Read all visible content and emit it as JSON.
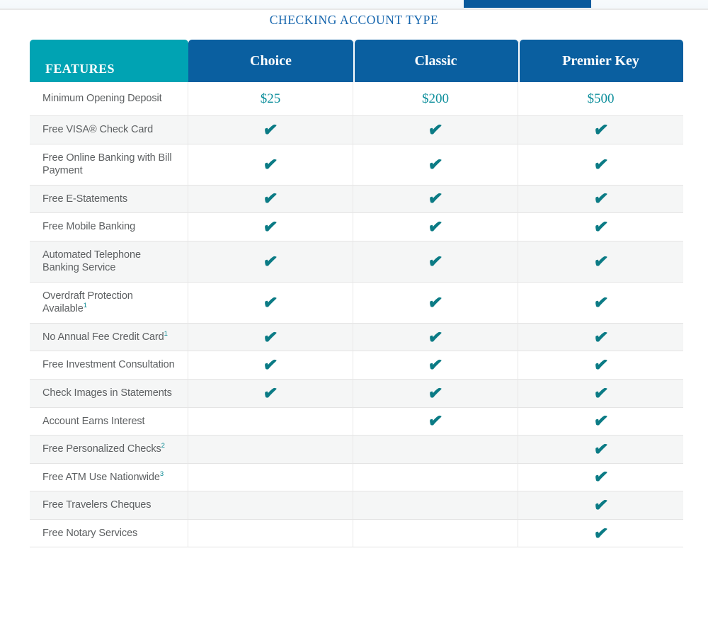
{
  "topbar": {
    "active_tab_label": ""
  },
  "page": {
    "title": "CHECKING ACCOUNT TYPE"
  },
  "colors": {
    "teal": "#00a3b3",
    "blue": "#0a5fa0",
    "check_teal": "#0b7b85",
    "price_teal": "#0e8f9c",
    "title_blue": "#1565ad",
    "row_stripe": "#f5f6f6",
    "feature_text": "#5d6062"
  },
  "table": {
    "features_header": "FEATURES",
    "columns": [
      {
        "label": "Choice"
      },
      {
        "label": "Classic"
      },
      {
        "label": "Premier Key"
      }
    ],
    "check_glyph": "✔",
    "rows": [
      {
        "feature": "Minimum Opening Deposit",
        "footnote": "",
        "type": "text",
        "values": [
          "$25",
          "$200",
          "$500"
        ]
      },
      {
        "feature": "Free VISA® Check Card",
        "footnote": "",
        "type": "check",
        "values": [
          true,
          true,
          true
        ]
      },
      {
        "feature": "Free Online Banking with Bill Payment",
        "footnote": "",
        "type": "check",
        "values": [
          true,
          true,
          true
        ]
      },
      {
        "feature": "Free E-Statements",
        "footnote": "",
        "type": "check",
        "values": [
          true,
          true,
          true
        ]
      },
      {
        "feature": "Free Mobile Banking",
        "footnote": "",
        "type": "check",
        "values": [
          true,
          true,
          true
        ]
      },
      {
        "feature": "Automated Telephone Banking Service",
        "footnote": "",
        "type": "check",
        "values": [
          true,
          true,
          true
        ]
      },
      {
        "feature": "Overdraft Protection Available",
        "footnote": "1",
        "type": "check",
        "values": [
          true,
          true,
          true
        ]
      },
      {
        "feature": "No Annual Fee Credit Card",
        "footnote": "1",
        "type": "check",
        "values": [
          true,
          true,
          true
        ]
      },
      {
        "feature": "Free Investment Consultation",
        "footnote": "",
        "type": "check",
        "values": [
          true,
          true,
          true
        ]
      },
      {
        "feature": "Check Images in Statements",
        "footnote": "",
        "type": "check",
        "values": [
          true,
          true,
          true
        ]
      },
      {
        "feature": "Account Earns Interest",
        "footnote": "",
        "type": "check",
        "values": [
          false,
          true,
          true
        ]
      },
      {
        "feature": "Free Personalized Checks",
        "footnote": "2",
        "type": "check",
        "values": [
          false,
          false,
          true
        ]
      },
      {
        "feature": "Free ATM Use Nationwide",
        "footnote": "3",
        "type": "check",
        "values": [
          false,
          false,
          true
        ]
      },
      {
        "feature": "Free Travelers Cheques",
        "footnote": "",
        "type": "check",
        "values": [
          false,
          false,
          true
        ]
      },
      {
        "feature": "Free Notary Services",
        "footnote": "",
        "type": "check",
        "values": [
          false,
          false,
          true
        ]
      }
    ]
  }
}
